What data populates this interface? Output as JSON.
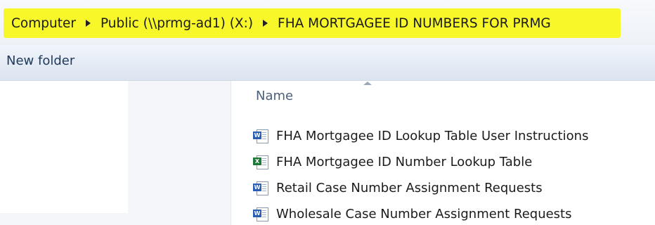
{
  "breadcrumb": {
    "items": [
      {
        "label": "Computer"
      },
      {
        "label": "Public (\\\\prmg-ad1) (X:)"
      },
      {
        "label": "FHA MORTGAGEE ID NUMBERS FOR PRMG"
      }
    ],
    "highlight_color": "#f7f72a"
  },
  "toolbar": {
    "new_folder_label": "New folder"
  },
  "file_list": {
    "column_header": "Name",
    "sort": "ascending",
    "files": [
      {
        "name": "FHA Mortgagee ID Lookup Table User Instructions",
        "icon": "word-document-icon"
      },
      {
        "name": "FHA Mortgagee ID Number Lookup Table",
        "icon": "excel-spreadsheet-icon"
      },
      {
        "name": "Retail Case Number Assignment Requests",
        "icon": "word-document-icon"
      },
      {
        "name": "Wholesale Case Number Assignment Requests",
        "icon": "word-document-icon"
      }
    ]
  }
}
